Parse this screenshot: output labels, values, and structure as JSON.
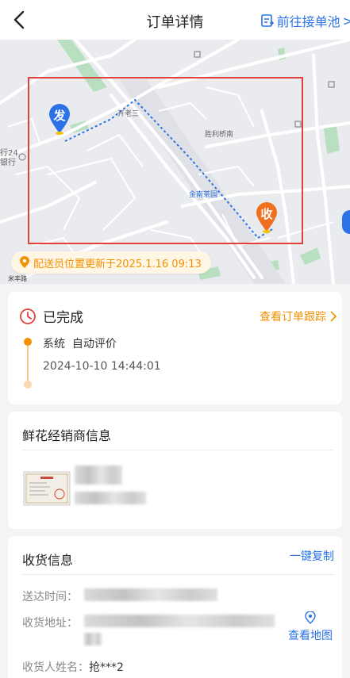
{
  "header": {
    "title": "订单详情",
    "pool_link": "前往接单池"
  },
  "map": {
    "sender_pin": "发",
    "receiver_pin": "收",
    "labels": [
      "开老三",
      "胜利桥南",
      "金南茶园",
      "行24",
      "银行",
      "楼子路",
      "吉顺路",
      "东桥北路",
      "武林路",
      "米丰路"
    ],
    "update_text": "配送员位置更新于2025.1.16 09:13"
  },
  "status": {
    "state": "已完成",
    "track_link": "查看订单跟踪",
    "event": "系统  自动评价",
    "event_time": "2024-10-10 14:44:01"
  },
  "vendor": {
    "title": "鲜花经销商信息"
  },
  "receive": {
    "title": "收货信息",
    "copy": "一键复制",
    "delivery_time_label": "送达时间：",
    "address_label": "收货地址：",
    "view_map": "查看地图",
    "receiver_name_label": "收货人姓名：",
    "receiver_name": "抢***2"
  },
  "colors": {
    "accent_blue": "#2a72e5",
    "accent_orange": "#f29100",
    "status_red": "#e0413a"
  }
}
